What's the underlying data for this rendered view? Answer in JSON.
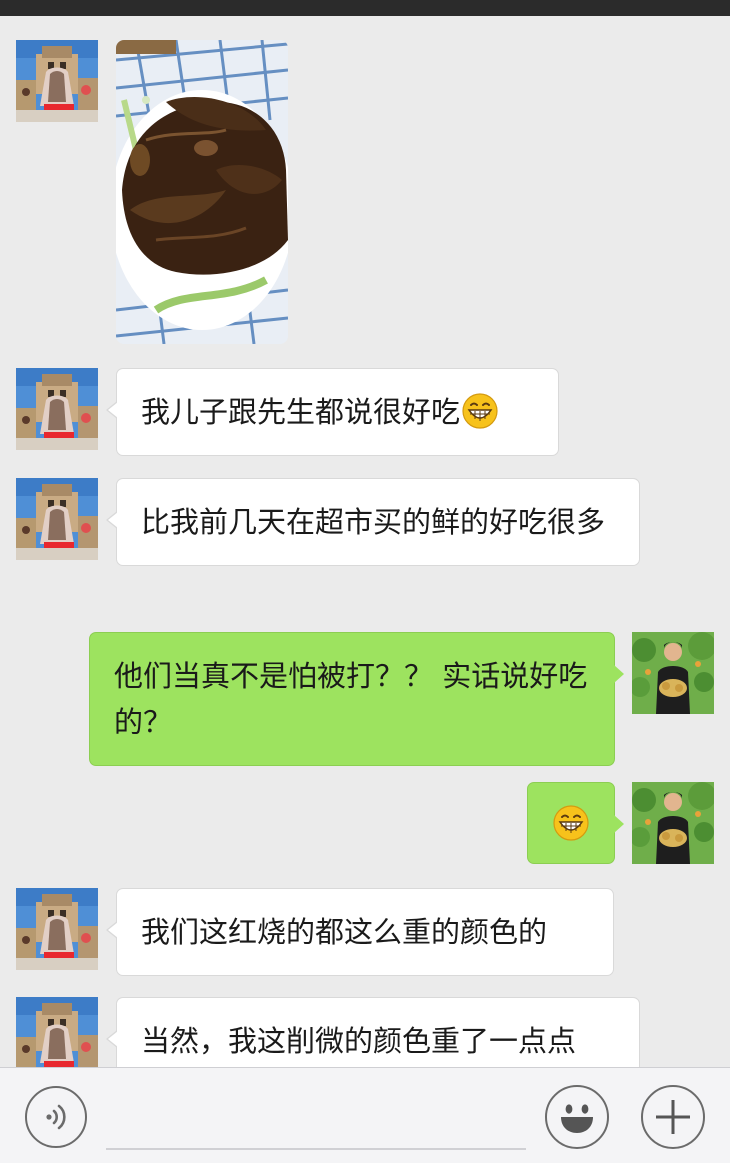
{
  "messages": [
    {
      "side": "left",
      "type": "image",
      "alt": "红烧削微"
    },
    {
      "side": "left",
      "type": "text",
      "text": "我儿子跟先生都说很好吃",
      "emoji": "grin-emoji"
    },
    {
      "side": "left",
      "type": "text",
      "text": "比我前几天在超市买的鲜的好吃很多"
    },
    {
      "side": "right",
      "type": "text",
      "text": "他们当真不是怕被打？？ 实话说好吃的？"
    },
    {
      "side": "right",
      "type": "emoji",
      "emoji": "grin-emoji"
    },
    {
      "side": "left",
      "type": "text",
      "text": "我们这红烧的都这么重的颜色的"
    },
    {
      "side": "left",
      "type": "text",
      "text": "当然，我这削微的颜色重了一点点"
    }
  ],
  "input_bar": {
    "voice_icon": "voice-icon",
    "emoji_icon": "smiley-icon",
    "plus_icon": "plus-icon",
    "placeholder": ""
  },
  "colors": {
    "background": "#ebebeb",
    "bubble_in": "#ffffff",
    "bubble_out": "#9de35f",
    "status_bar": "#2b2b2b",
    "input_bar": "#f4f4f6"
  }
}
